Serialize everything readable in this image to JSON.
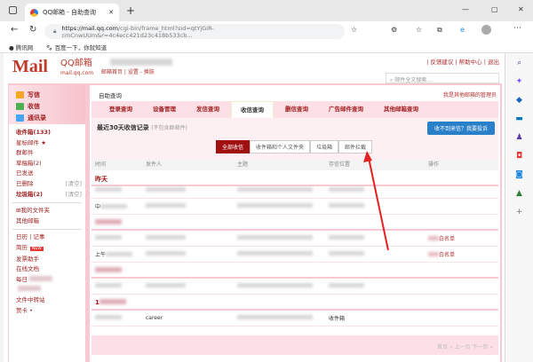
{
  "browser": {
    "tab_title": "QQ邮箱 - 自助查询",
    "new_tab": "+",
    "url_host": "https://mail.qq.com",
    "url_rest": "/cgi-bin/frame_html?sid=qtYjGiR-cmCnwUUm&r=4c4ecc421d23c418b533cb...",
    "min": "—",
    "max": "▢",
    "close": "✕",
    "bookmarks": [
      "腾讯网",
      "百度一下，你就知道"
    ]
  },
  "header": {
    "logo": "Mail",
    "brand": "QQ邮箱",
    "domain": "mail.qq.com",
    "links": "邮箱首页 | 设置 - 换肤",
    "top_links": "| 反馈建议 | 帮助中心 | 退出",
    "search_placeholder": "邮件全文搜索..."
  },
  "sidebar": {
    "write": "写信",
    "receive": "收信",
    "contacts": "通讯录",
    "folders": [
      {
        "label": "收件箱(133)",
        "bold": true
      },
      {
        "label": "星标邮件 ★"
      },
      {
        "label": "群邮件"
      },
      {
        "label": "草稿箱(2)"
      },
      {
        "label": "已发送"
      },
      {
        "label": "已删除",
        "action": "[清空]"
      },
      {
        "label": "垃圾箱(2)",
        "bold": true,
        "action": "[清空]"
      }
    ],
    "my_folders": "⊞我的文件夹",
    "other": "其他邮箱",
    "apps": [
      "日历 | 记事",
      "简历",
      "发票助手",
      "在线文档",
      "每日",
      "",
      "文件中转站",
      "贺卡 •"
    ],
    "new_badge": "NEW"
  },
  "main": {
    "title": "自助查询",
    "admin_link": "我是其他邮箱的管理员",
    "tabs": [
      "登录查询",
      "设备管理",
      "发信查询",
      "收信查询",
      "删信查询",
      "广告邮件查询",
      "其他邮箱查询"
    ],
    "active_tab": 3,
    "section_title": "最近30天收信记录",
    "section_note": "(不包含群邮件)",
    "complain_button": "收不到来信？我要投诉",
    "filters": [
      "全部收信",
      "收件箱和个人文件夹",
      "垃圾箱",
      "邮件拦截"
    ],
    "columns": [
      "时间",
      "发件人",
      "主题",
      "存信位置",
      "操作"
    ],
    "group_yesterday": "昨天",
    "group_date": "1",
    "row_time_1": "中",
    "row_time_2": "上午",
    "row_sender_last": "career",
    "row_loc_last": "收件箱",
    "whitelist": "白名单",
    "pager": "首页 « 上一页 下一页 »"
  }
}
